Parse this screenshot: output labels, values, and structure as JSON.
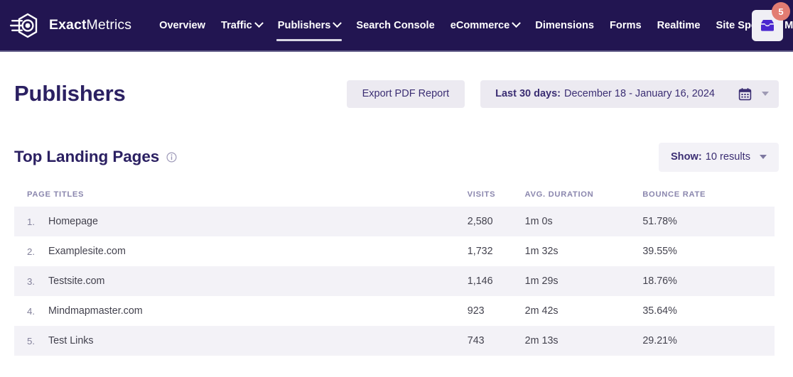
{
  "nav": {
    "brand": {
      "bold": "Exact",
      "light": "Metrics",
      "logo_icon": "exactmetrics-logo-icon"
    },
    "items": [
      {
        "label": "Overview",
        "has_caret": false,
        "active": false
      },
      {
        "label": "Traffic",
        "has_caret": true,
        "active": false
      },
      {
        "label": "Publishers",
        "has_caret": true,
        "active": true
      },
      {
        "label": "Search Console",
        "has_caret": false,
        "active": false
      },
      {
        "label": "eCommerce",
        "has_caret": true,
        "active": false
      },
      {
        "label": "Dimensions",
        "has_caret": false,
        "active": false
      },
      {
        "label": "Forms",
        "has_caret": false,
        "active": false
      },
      {
        "label": "Realtime",
        "has_caret": false,
        "active": false
      },
      {
        "label": "Site Speed",
        "has_caret": false,
        "active": false
      },
      {
        "label": "Media",
        "has_caret": false,
        "active": false
      }
    ],
    "inbox": {
      "icon": "inbox-icon",
      "badge_count": "5"
    }
  },
  "header": {
    "title": "Publishers",
    "export_label": "Export PDF Report",
    "date_range_label": "Last 30 days:",
    "date_range_value": "December 18 - January 16, 2024",
    "calendar_icon": "calendar-icon",
    "dropdown_icon": "chevron-down-icon"
  },
  "section": {
    "title": "Top Landing Pages",
    "info_icon": "info-icon",
    "show_label": "Show:",
    "show_value": "10 results"
  },
  "table": {
    "columns": [
      "PAGE TITLES",
      "VISITS",
      "AVG. DURATION",
      "BOUNCE RATE"
    ],
    "rows": [
      {
        "rank": "1.",
        "page": "Homepage",
        "visits": "2,580",
        "duration": "1m 0s",
        "bounce": "51.78%"
      },
      {
        "rank": "2.",
        "page": "Examplesite.com",
        "visits": "1,732",
        "duration": "1m 32s",
        "bounce": "39.55%"
      },
      {
        "rank": "3.",
        "page": "Testsite.com",
        "visits": "1,146",
        "duration": "1m 29s",
        "bounce": "18.76%"
      },
      {
        "rank": "4.",
        "page": "Mindmapmaster.com",
        "visits": "923",
        "duration": "2m 42s",
        "bounce": "35.64%"
      },
      {
        "rank": "5.",
        "page": "Test Links",
        "visits": "743",
        "duration": "2m 13s",
        "bounce": "29.21%"
      }
    ]
  },
  "colors": {
    "nav_bg": "#221551",
    "brand_purple": "#2b2062",
    "accent_violet": "#4b28cf",
    "badge_red": "#e27c72",
    "row_stripe": "#f3f2f7",
    "muted_text": "#8b87ae"
  }
}
